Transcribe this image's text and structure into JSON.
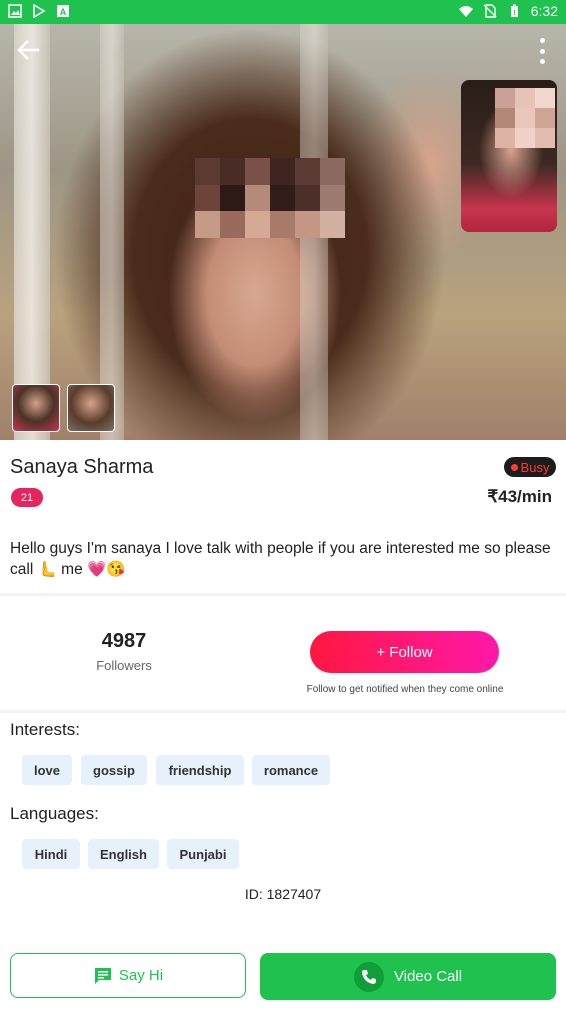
{
  "status_bar": {
    "time": "6:32",
    "icons": [
      "image-icon",
      "play-store-icon",
      "text-icon",
      "wifi-icon",
      "no-sim-icon",
      "battery-icon"
    ]
  },
  "profile": {
    "name": "Sanaya Sharma",
    "status": "Busy",
    "age": "21",
    "rate": "₹43/min",
    "bio": "Hello guys I'm sanaya I love talk with people if you are interested me so please call 🫷 me 💗😘"
  },
  "stats": {
    "followers_count": "4987",
    "followers_label": "Followers",
    "follow_button": "+ Follow",
    "follow_hint": "Follow to get notified when they come online"
  },
  "interests": {
    "title": "Interests:",
    "items": [
      "love",
      "gossip",
      "friendship",
      "romance"
    ]
  },
  "languages": {
    "title": "Languages:",
    "items": [
      "Hindi",
      "English",
      "Punjabi"
    ]
  },
  "profile_id": "ID: 1827407",
  "actions": {
    "say_hi": "Say Hi",
    "video_call": "Video Call"
  },
  "colors": {
    "brand_green": "#1fc24f",
    "follow_gradient_start": "#ff1740",
    "follow_gradient_end": "#ff18a9",
    "age_badge": "#e6245e",
    "chip_bg": "#e6f1fb"
  }
}
